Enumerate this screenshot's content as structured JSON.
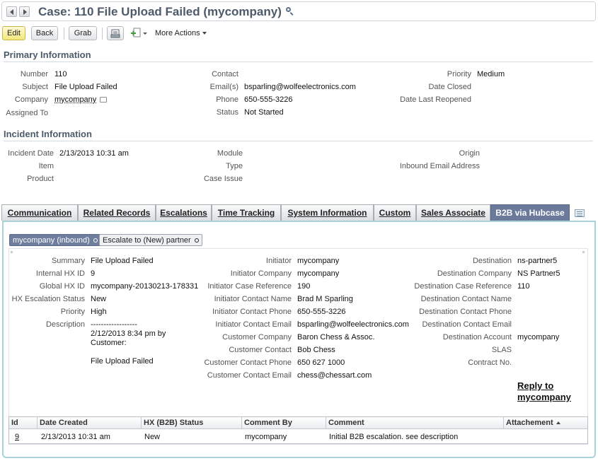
{
  "header": {
    "title": "Case: 110 File Upload Failed (mycompany)"
  },
  "toolbar": {
    "edit_label": "Edit",
    "back_label": "Back",
    "grab_label": "Grab",
    "more_actions_label": "More Actions"
  },
  "primary": {
    "heading": "Primary Information",
    "number_label": "Number",
    "number": "110",
    "subject_label": "Subject",
    "subject": "File Upload Failed",
    "company_label": "Company",
    "company": "mycompany",
    "assigned_to_label": "Assigned To",
    "contact_label": "Contact",
    "emails_label": "Email(s)",
    "emails": "bsparling@wolfeelectronics.com",
    "phone_label": "Phone",
    "phone": "650-555-3226",
    "status_label": "Status",
    "status": "Not Started",
    "priority_label": "Priority",
    "priority": "Medium",
    "date_closed_label": "Date Closed",
    "date_reopened_label": "Date Last Reopened"
  },
  "incident": {
    "heading": "Incident Information",
    "incident_date_label": "Incident Date",
    "incident_date": "2/13/2013 10:31 am",
    "item_label": "Item",
    "product_label": "Product",
    "module_label": "Module",
    "type_label": "Type",
    "case_issue_label": "Case Issue",
    "origin_label": "Origin",
    "inbound_email_label": "Inbound Email Address"
  },
  "tabs": [
    {
      "label": "Communication"
    },
    {
      "label": "Related Records"
    },
    {
      "label": "Escalations"
    },
    {
      "label": "Time Tracking"
    },
    {
      "label": "System Information"
    },
    {
      "label": "Custom"
    },
    {
      "label": "Sales Associate"
    },
    {
      "label": "B2B via Hubcase"
    }
  ],
  "subtabs": [
    {
      "label": "mycompany (inbound)"
    },
    {
      "label": "Escalate to (New) partner"
    }
  ],
  "b2b": {
    "summary_label": "Summary",
    "summary": "File Upload Failed",
    "internal_hx_id_label": "Internal HX ID",
    "internal_hx_id": "9",
    "global_hx_id_label": "Global HX ID",
    "global_hx_id": "mycompany-20130213-178331",
    "hx_escalation_status_label": "HX Escalation Status",
    "hx_escalation_status": "New",
    "priority_label": "Priority",
    "priority": "High",
    "description_label": "Description",
    "description_line1": "------------------",
    "description_line2": "2/12/2013 8:34 pm by",
    "description_line3": "Customer:",
    "description_line4": "File Upload Failed",
    "initiator_label": "Initiator",
    "initiator": "mycompany",
    "initiator_company_label": "Initiator Company",
    "initiator_company": "mycompany",
    "initiator_case_ref_label": "Initiator Case Reference",
    "initiator_case_ref": "190",
    "initiator_contact_name_label": "Initiator Contact Name",
    "initiator_contact_name": "Brad M Sparling",
    "initiator_contact_phone_label": "Initiator Contact Phone",
    "initiator_contact_phone": "650-555-3226",
    "initiator_contact_email_label": "Initiator Contact Email",
    "initiator_contact_email": "bsparling@wolfeelectronics.com",
    "customer_company_label": "Customer Company",
    "customer_company": "Baron Chess & Assoc.",
    "customer_contact_label": "Customer Contact",
    "customer_contact": "Bob Chess",
    "customer_contact_phone_label": "Customer Contact Phone",
    "customer_contact_phone": "650 627 1000",
    "customer_contact_email_label": "Customer Contact Email",
    "customer_contact_email": "chess@chessart.com",
    "destination_label": "Destination",
    "destination": "ns-partner5",
    "destination_company_label": "Destination Company",
    "destination_company": "NS Partner5",
    "destination_case_ref_label": "Destination Case Reference",
    "destination_case_ref": "110",
    "destination_contact_name_label": "Destination Contact Name",
    "destination_contact_phone_label": "Destination Contact Phone",
    "destination_contact_email_label": "Destination Contact Email",
    "destination_account_label": "Destination Account",
    "destination_account": "mycompany",
    "slas_label": "SLAS",
    "contract_no_label": "Contract No.",
    "reply_line1": "Reply to",
    "reply_line2": "mycompany"
  },
  "grid": {
    "columns": [
      "Id",
      "Date Created",
      "HX (B2B) Status",
      "Comment By",
      "Comment",
      "Attachement"
    ],
    "rows": [
      [
        "9",
        "2/13/2013 10:31 am",
        "New",
        "mycompany",
        "Initial B2B escalation. see description",
        ""
      ]
    ]
  }
}
